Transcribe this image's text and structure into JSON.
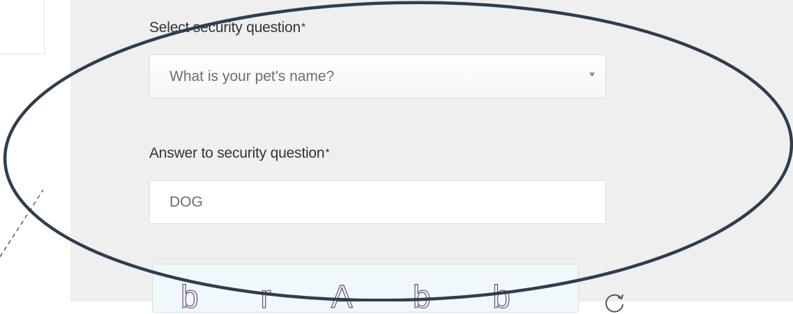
{
  "security_question": {
    "label": "Select security question",
    "required_mark": "*",
    "selected_value": "What is your pet's name?"
  },
  "security_answer": {
    "label": "Answer to security question",
    "required_mark": "*",
    "value": "DOG"
  },
  "captcha": {
    "text": "b r A b b"
  },
  "colors": {
    "panel_background": "#efefef",
    "annotation_ellipse": "#2f3e4e"
  }
}
